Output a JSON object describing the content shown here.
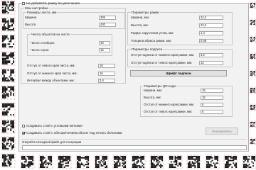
{
  "top_checkbox": {
    "label": "Не добавлять рамку по умолчанию",
    "checked": false
  },
  "sheet_settings": {
    "title": "Мои настройки",
    "sheet_size": {
      "title": "Размеры листа, мм",
      "width_label": "Ширина",
      "width_value": "305",
      "height_label": "Высота",
      "height_value": "430"
    },
    "objects": {
      "title": "Число объектов на листе",
      "columns_label": "Число столбцов:",
      "columns_value": "10",
      "rows_label": "Число строк:",
      "rows_value": "15"
    },
    "left_margin_label": "Отступ от левого края листа, мм:",
    "left_margin_value": "16",
    "bottom_margin_label": "Отступ от нижнего края листа, мм:",
    "bottom_margin_value": "16",
    "interval_label": "Интервал между объектами, мм:",
    "interval_value": "3,4"
  },
  "frame_params": {
    "title": "Параметры рамки",
    "width_label": "Ширина, мм:",
    "width_value": "24,2",
    "height_label": "Высота, мм:",
    "height_value": "23,2",
    "radius_label": "Радиус скругления углов, мм:",
    "radius_value": "1,4",
    "thickness_label": "Толщина абриса рамки, мм:",
    "thickness_value": "0,08"
  },
  "caption_params": {
    "title": "Параметры подписи",
    "bottom_label": "Отступ подписи от нижнего края рамки, мм:",
    "bottom_value": "3,2",
    "left_label": "Отступ подписи от левого края рамки, мм:",
    "left_value": "12",
    "font_button": "Шрифт подписи"
  },
  "qr_params": {
    "title": "Параметры QR-кода",
    "width_label": "Ширина, мм:",
    "width_value": "15",
    "height_label": "Высота, мм:",
    "height_value": "15",
    "bottom_label": "Отступ от нижнего края рамки, мм:",
    "bottom_value": "6",
    "left_label": "Отступ от левого края рамки, мм:",
    "left_value": "5"
  },
  "options": {
    "corner_marks_label": "Создавать слой с угловыми метками",
    "corner_marks_checked": false,
    "white_fill_label": "Создавать слой с обесцвечением объект под печать белилами",
    "white_fill_checked": true
  },
  "generate_button": "Генерировать",
  "source_file": {
    "label": "Откройте исходный файл для генерации",
    "value": ""
  },
  "colors": {
    "dialog_bg": "#f2f2f2",
    "cut_line": "#e06060"
  }
}
